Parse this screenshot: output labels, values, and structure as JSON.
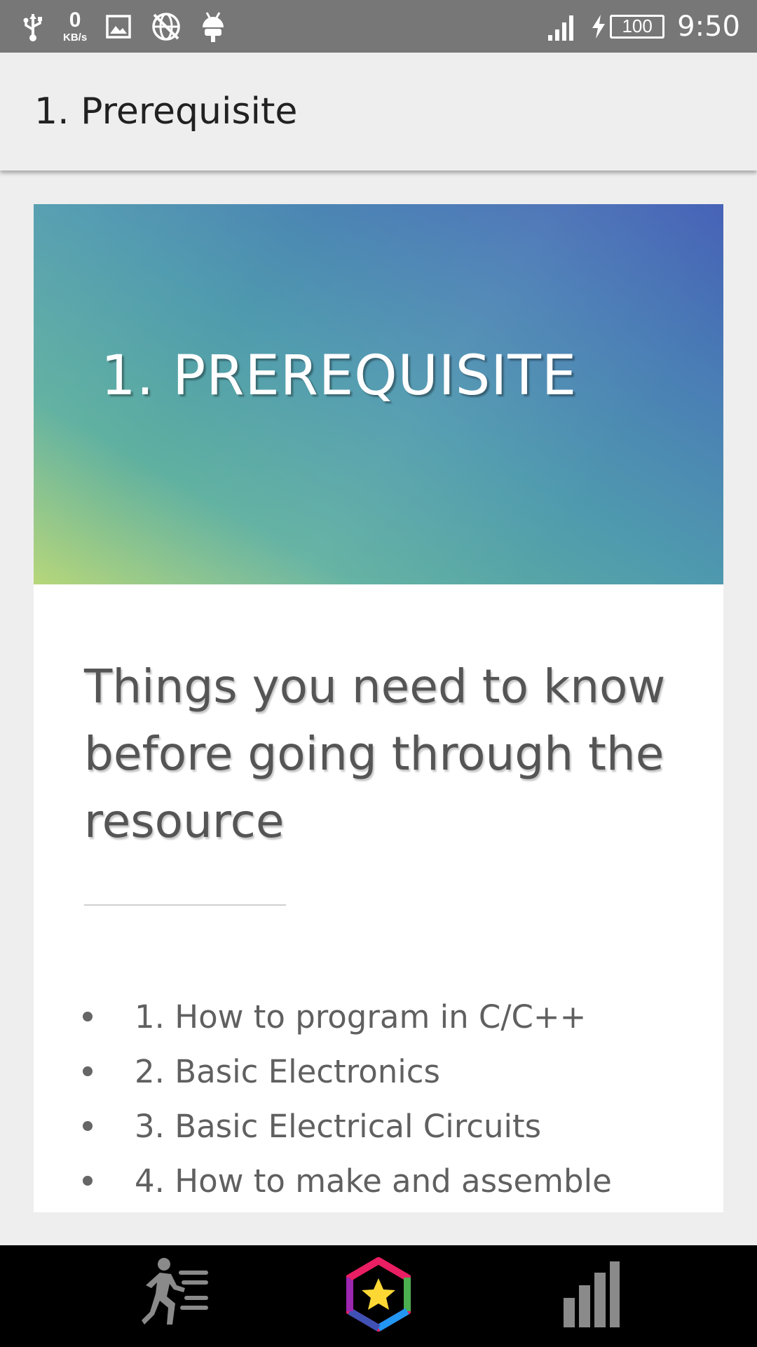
{
  "status_bar": {
    "net_speed_value": "0",
    "net_speed_unit": "KB/s",
    "battery_level": "100",
    "time": "9:50",
    "icons": [
      "usb-icon",
      "image-icon",
      "no-network-icon",
      "android-debug-icon",
      "signal-icon",
      "charging-icon",
      "battery-icon"
    ]
  },
  "app_bar": {
    "title": "1. Prerequisite"
  },
  "card": {
    "banner_title": "1. PREREQUISITE",
    "heading": "Things you need to know before going through the resource",
    "items": [
      "1. How to program in C/C++",
      "2. Basic Electronics",
      "3. Basic Electrical Circuits",
      "4. How to make and assemble"
    ]
  },
  "bottom_nav": {
    "items": [
      "running-lessons-icon",
      "star-hexagon-icon",
      "bar-chart-icon"
    ]
  },
  "colors": {
    "status_bar": "#777777",
    "background": "#eeeeee",
    "bottom_nav": "#000000",
    "banner_start": "#b7d77a",
    "banner_end": "#4460b6"
  }
}
